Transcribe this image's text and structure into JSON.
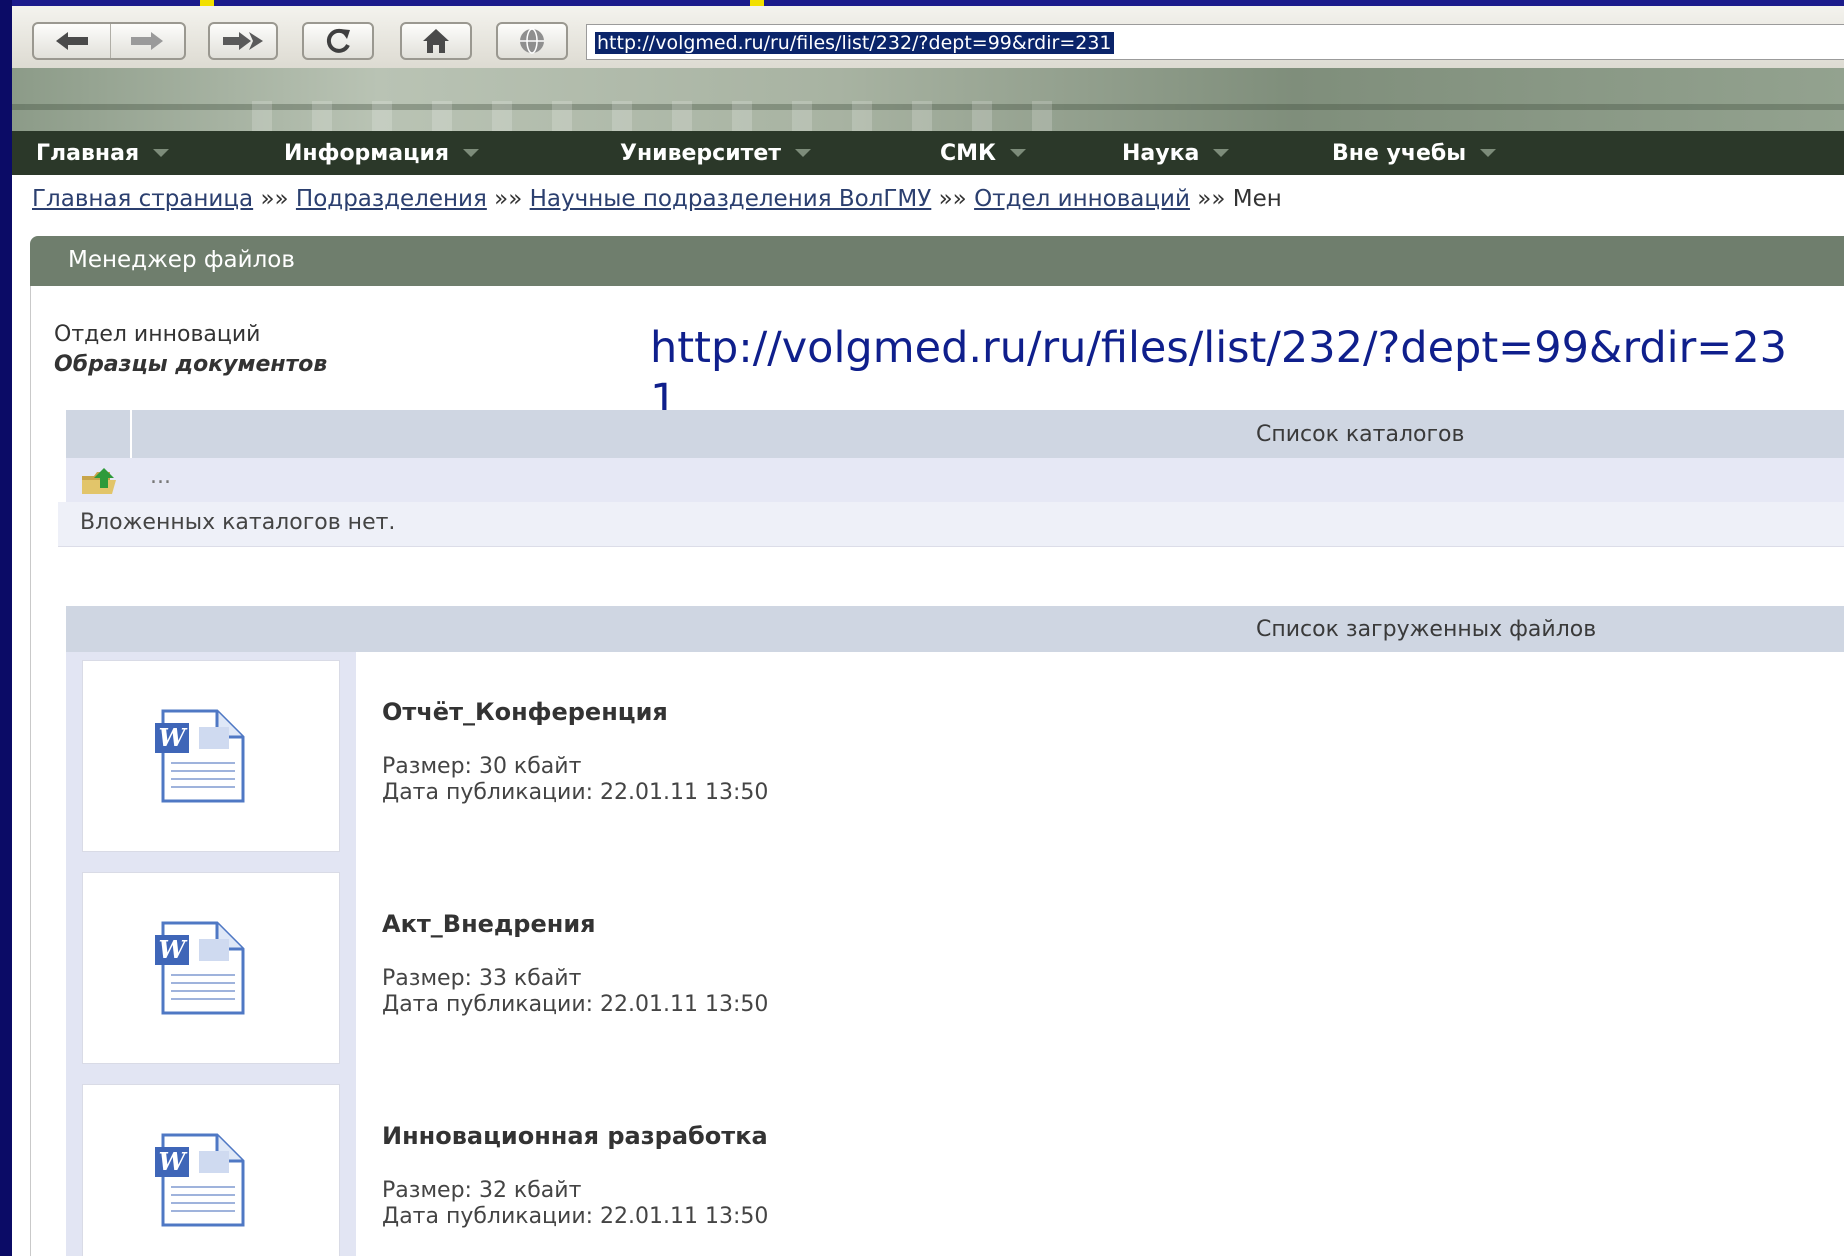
{
  "browser": {
    "address_url": "http://volgmed.ru/ru/files/list/232/?dept=99&rdir=231"
  },
  "nav": {
    "items": [
      {
        "label": "Главная"
      },
      {
        "label": "Информация"
      },
      {
        "label": "Университет"
      },
      {
        "label": "СМК"
      },
      {
        "label": "Наука"
      },
      {
        "label": "Вне учебы"
      }
    ]
  },
  "breadcrumb": {
    "links": [
      {
        "label": "Главная страница"
      },
      {
        "label": "Подразделения"
      },
      {
        "label": "Научные подразделения ВолГМУ"
      },
      {
        "label": "Отдел инноваций"
      }
    ],
    "separator": "»»",
    "current": "Мен"
  },
  "panel": {
    "title": "Менеджер файлов",
    "department": "Отдел инноваций",
    "subtitle": "Образцы документов"
  },
  "overlay_url": "http://volgmed.ru/ru/files/list/232/?dept=99&rdir=231",
  "catalogs": {
    "header": "Список каталогов",
    "up_label": "...",
    "empty_text": "Вложенных каталогов нет."
  },
  "files": {
    "header": "Список загруженных файлов",
    "items": [
      {
        "name": "Отчёт_Конференция",
        "size": "Размер: 30 кбайт",
        "date": "Дата публикации: 22.01.11 13:50",
        "icon": "word-document-icon"
      },
      {
        "name": "Акт_Внедрения",
        "size": "Размер: 33 кбайт",
        "date": "Дата публикации: 22.01.11 13:50",
        "icon": "word-document-icon"
      },
      {
        "name": "Инновационная разработка",
        "size": "Размер: 32 кбайт",
        "date": "Дата публикации: 22.01.11 13:50",
        "icon": "word-document-icon"
      }
    ]
  },
  "colors": {
    "navbar": "#2b3829",
    "panel_header": "#6f7e6d",
    "table_header": "#cfd6e2",
    "link": "#2b3f6f",
    "overlay_text": "#0f1f8c"
  }
}
